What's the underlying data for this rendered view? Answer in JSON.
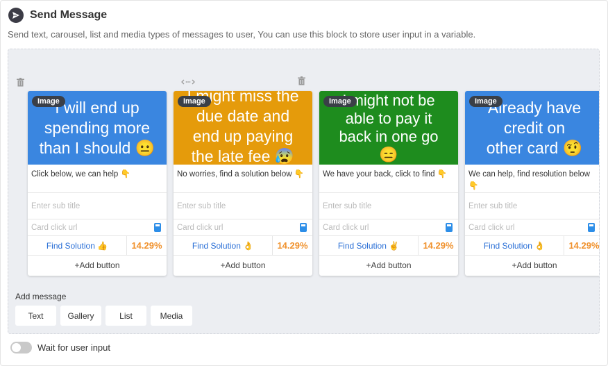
{
  "header": {
    "title": "Send Message",
    "subtitle": "Send text, carousel, list and media types of messages to user, You can use this block to store user input in a variable.",
    "icon": "send-icon"
  },
  "cards": [
    {
      "image_color": "#3a86e0",
      "image_badge": "Image",
      "image_text": "I will end up\nspending more\nthan I should 😐",
      "title": "Click below, we can help 👇",
      "subtitle_placeholder": "Enter sub title",
      "url_placeholder": "Card click url",
      "button_label": "Find Solution 👍",
      "button_percent": "14.29%",
      "add_button": "+Add button"
    },
    {
      "image_color": "#e59b0b",
      "image_badge": "Image",
      "image_text": "I might miss the\ndue date and\nend up paying\nthe late fee 😰",
      "title": "No worries, find a solution below 👇",
      "subtitle_placeholder": "Enter sub title",
      "url_placeholder": "Card click url",
      "button_label": "Find Solution 👌",
      "button_percent": "14.29%",
      "add_button": "+Add button"
    },
    {
      "image_color": "#1e8c1e",
      "image_badge": "Image",
      "image_text": "I might not be\nable to pay it\nback in one go\n😑",
      "title": "We have your back, click to find 👇",
      "subtitle_placeholder": "Enter sub title",
      "url_placeholder": "Card click url",
      "button_label": "Find Solution ✌",
      "button_percent": "14.29%",
      "add_button": "+Add button"
    },
    {
      "image_color": "#3a86e0",
      "image_badge": "Image",
      "image_text": "Already have\ncredit on\nother card 🤨",
      "title": "We can help, find resolution below 👇",
      "subtitle_placeholder": "Enter sub title",
      "url_placeholder": "Card click url",
      "button_label": "Find Solution 👌",
      "button_percent": "14.29%",
      "add_button": "+Add button"
    }
  ],
  "add_message": {
    "label": "Add message",
    "buttons": [
      "Text",
      "Gallery",
      "List",
      "Media"
    ]
  },
  "wait_input": {
    "label": "Wait for user input",
    "enabled": false
  },
  "colors": {
    "percent": "#f0922e",
    "link": "#2a6fd6",
    "url_icon": "#2d8ee8"
  }
}
